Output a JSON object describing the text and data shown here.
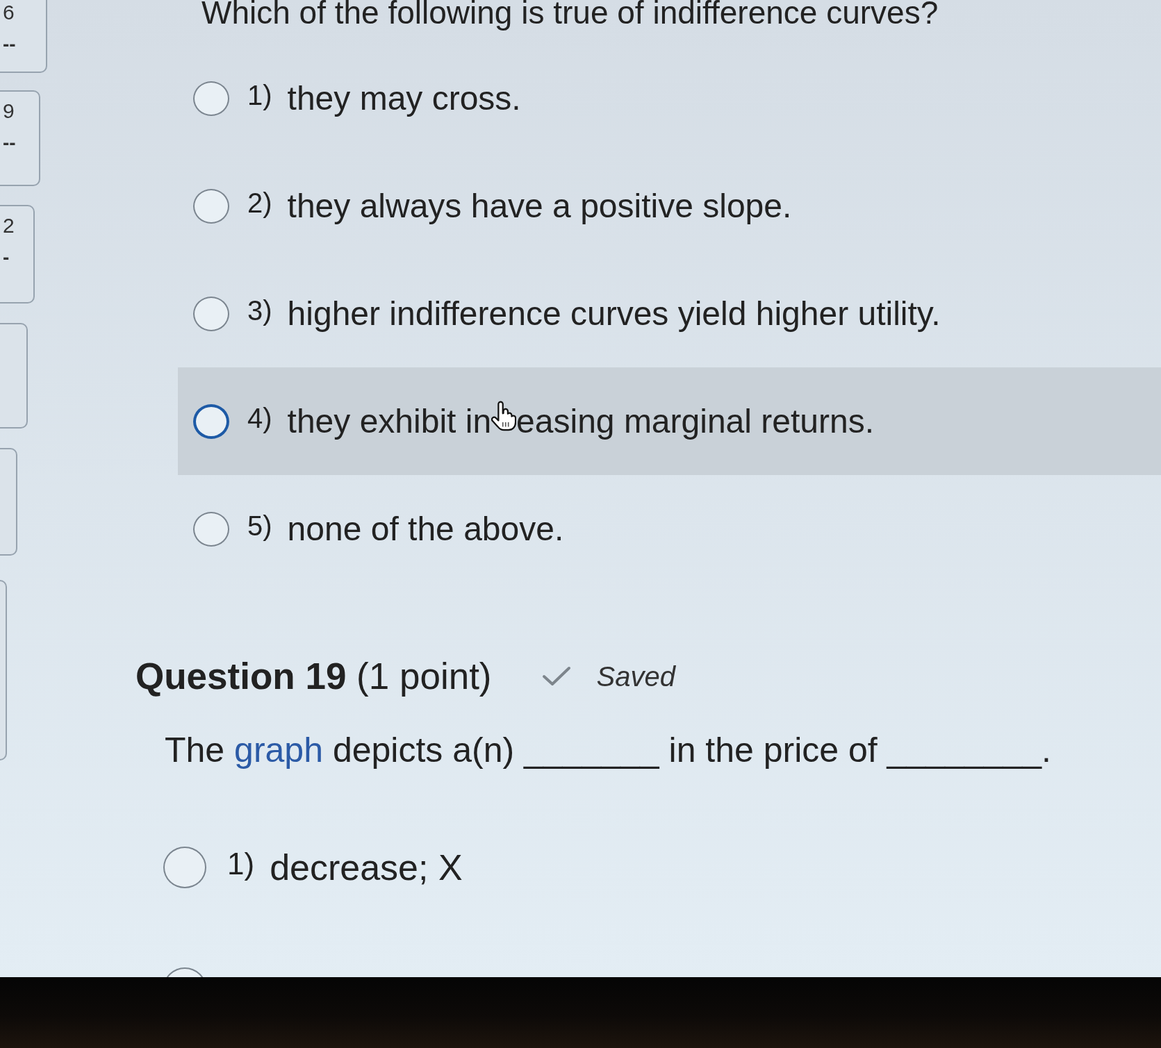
{
  "sidebar": {
    "tiles": [
      {
        "kind": "numbered",
        "number": "6",
        "status": "--"
      },
      {
        "kind": "numbered",
        "number": "9",
        "status": "--"
      },
      {
        "kind": "numbered",
        "number": "2",
        "status": "-"
      },
      {
        "kind": "cut_off"
      },
      {
        "kind": "cut_off"
      },
      {
        "kind": "cut_off"
      }
    ]
  },
  "questions": [
    {
      "text": "Which of the following is true of indifference curves?",
      "options": [
        {
          "number": "1)",
          "text": "they may cross.",
          "selected": false,
          "hovered": false
        },
        {
          "number": "2)",
          "text": "they always have a positive slope.",
          "selected": false,
          "hovered": false
        },
        {
          "number": "3)",
          "text": "higher indifference curves yield higher utility.",
          "selected": false,
          "hovered": false
        },
        {
          "number": "4)",
          "text": "they exhibit in",
          "text_after_cursor": "easing marginal returns.",
          "selected": false,
          "hovered": true
        },
        {
          "number": "5)",
          "text": "none of the above.",
          "selected": false,
          "hovered": false
        }
      ]
    },
    {
      "heading": "**Question 19** (1 point)",
      "save_status": "Saved",
      "prompt": {
        "before": "The",
        "link": "graph",
        "after": "depicts a(n) _______ in the price of ________."
      },
      "options": [
        {
          "number": "1)",
          "text": "decrease; X",
          "selected": false,
          "hovered": false
        },
        {
          "selected": false,
          "hovered": false
        }
      ]
    }
  ]
}
